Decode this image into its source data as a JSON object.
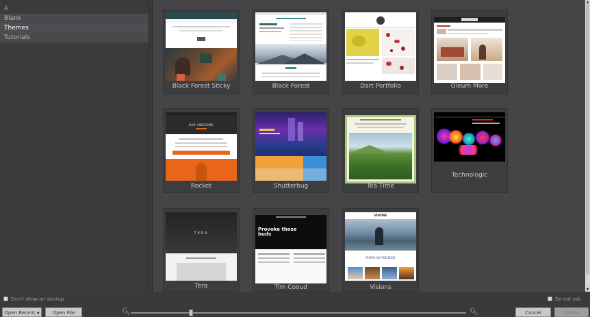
{
  "sidebar": {
    "items": [
      {
        "label": "A",
        "state": "header"
      },
      {
        "label": "Blank",
        "state": "dim"
      },
      {
        "label": "Themes",
        "state": "selected"
      },
      {
        "label": "Tutorials",
        "state": "dim"
      }
    ]
  },
  "gallery": {
    "themes": [
      {
        "label": "Black Forest Sticky"
      },
      {
        "label": "Black Forest"
      },
      {
        "label": "Dart Portfolio"
      },
      {
        "label": "Oleum More"
      },
      {
        "label": "Rocket"
      },
      {
        "label": "Shutterbug"
      },
      {
        "label": "Tea Time"
      },
      {
        "label": "Technologic"
      },
      {
        "label": "Tera"
      },
      {
        "label": "Tim Cooud"
      },
      {
        "label": "Visions"
      }
    ],
    "thumb_text": {
      "rocket_heading": "OUR AWESOME",
      "tera_heading": "TERA",
      "provoke_heading": "Provoke those buds",
      "visions_banner": "VISIONS",
      "visions_caption": "PHOTO ON THE EDGE"
    }
  },
  "footer": {
    "dont_show_label": "Don't show on startup",
    "open_recent_label": "Open Recent",
    "open_file_label": "Open File",
    "right_check_label": "Do not ask",
    "cancel_label": "Cancel",
    "create_label": "Create"
  },
  "colors": {
    "background": "#3a3a3c",
    "gallery": "#454548",
    "selected": "#4e4e52",
    "rocket_orange": "#e8651a"
  }
}
